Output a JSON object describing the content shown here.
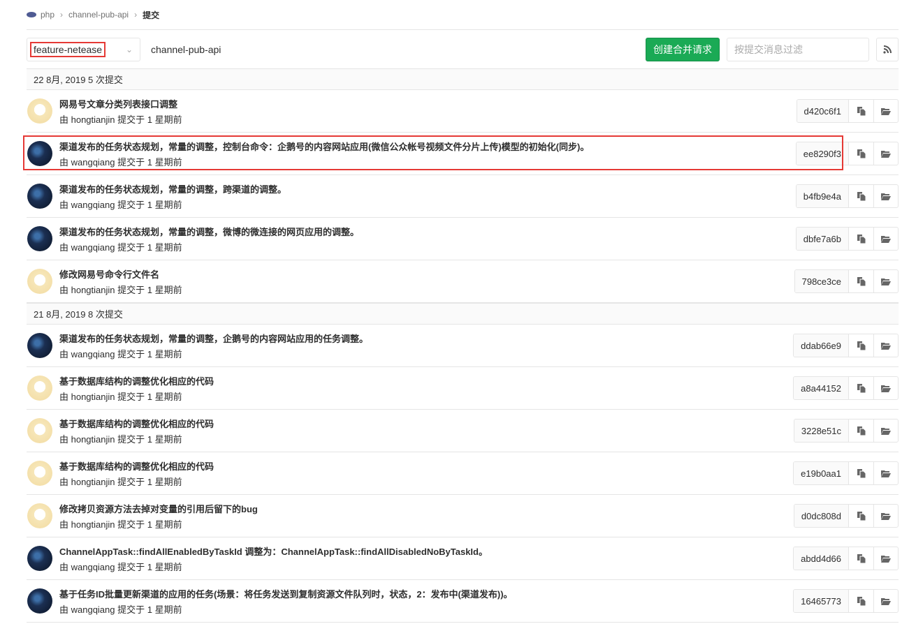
{
  "breadcrumb": {
    "group": "php",
    "project": "channel-pub-api",
    "current": "提交"
  },
  "toolbar": {
    "branch": "feature-netease",
    "project_path": "channel-pub-api",
    "create_mr": "创建合并请求",
    "filter_placeholder": "按提交消息过滤"
  },
  "days": [
    {
      "header": "22 8月, 2019 5 次提交",
      "commits": [
        {
          "title": "网易号文章分类列表接口调整",
          "meta": "由 hongtianjin 提交于 1 星期前",
          "sha": "d420c6f1",
          "avatar": "h"
        },
        {
          "title": "渠道发布的任务状态规划，常量的调整，控制台命令：企鹅号的内容网站应用(微信公众帐号视频文件分片上传)模型的初始化(同步)。",
          "meta": "由 wangqiang 提交于 1 星期前",
          "sha": "ee8290f3",
          "avatar": "w",
          "highlight": true
        },
        {
          "title": "渠道发布的任务状态规划，常量的调整，跨渠道的调整。",
          "meta": "由 wangqiang 提交于 1 星期前",
          "sha": "b4fb9e4a",
          "avatar": "w"
        },
        {
          "title": "渠道发布的任务状态规划，常量的调整，微博的微连接的网页应用的调整。",
          "meta": "由 wangqiang 提交于 1 星期前",
          "sha": "dbfe7a6b",
          "avatar": "w"
        },
        {
          "title": "修改网易号命令行文件名",
          "meta": "由 hongtianjin 提交于 1 星期前",
          "sha": "798ce3ce",
          "avatar": "h"
        }
      ]
    },
    {
      "header": "21 8月, 2019 8 次提交",
      "commits": [
        {
          "title": "渠道发布的任务状态规划，常量的调整，企鹅号的内容网站应用的任务调整。",
          "meta": "由 wangqiang 提交于 1 星期前",
          "sha": "ddab66e9",
          "avatar": "w"
        },
        {
          "title": "基于数据库结构的调整优化相应的代码",
          "meta": "由 hongtianjin 提交于 1 星期前",
          "sha": "a8a44152",
          "avatar": "h"
        },
        {
          "title": "基于数据库结构的调整优化相应的代码",
          "meta": "由 hongtianjin 提交于 1 星期前",
          "sha": "3228e51c",
          "avatar": "h"
        },
        {
          "title": "基于数据库结构的调整优化相应的代码",
          "meta": "由 hongtianjin 提交于 1 星期前",
          "sha": "e19b0aa1",
          "avatar": "h"
        },
        {
          "title": "修改拷贝资源方法去掉对变量的引用后留下的bug",
          "meta": "由 hongtianjin 提交于 1 星期前",
          "sha": "d0dc808d",
          "avatar": "h"
        },
        {
          "title": "ChannelAppTask::findAllEnabledByTaskId 调整为：ChannelAppTask::findAllDisabledNoByTaskId。",
          "meta": "由 wangqiang 提交于 1 星期前",
          "sha": "abdd4d66",
          "avatar": "w"
        },
        {
          "title": "基于任务ID批量更新渠道的应用的任务(场景：将任务发送到复制资源文件队列时，状态，2：发布中(渠道发布))。",
          "meta": "由 wangqiang 提交于 1 星期前",
          "sha": "16465773",
          "avatar": "w"
        }
      ]
    }
  ]
}
